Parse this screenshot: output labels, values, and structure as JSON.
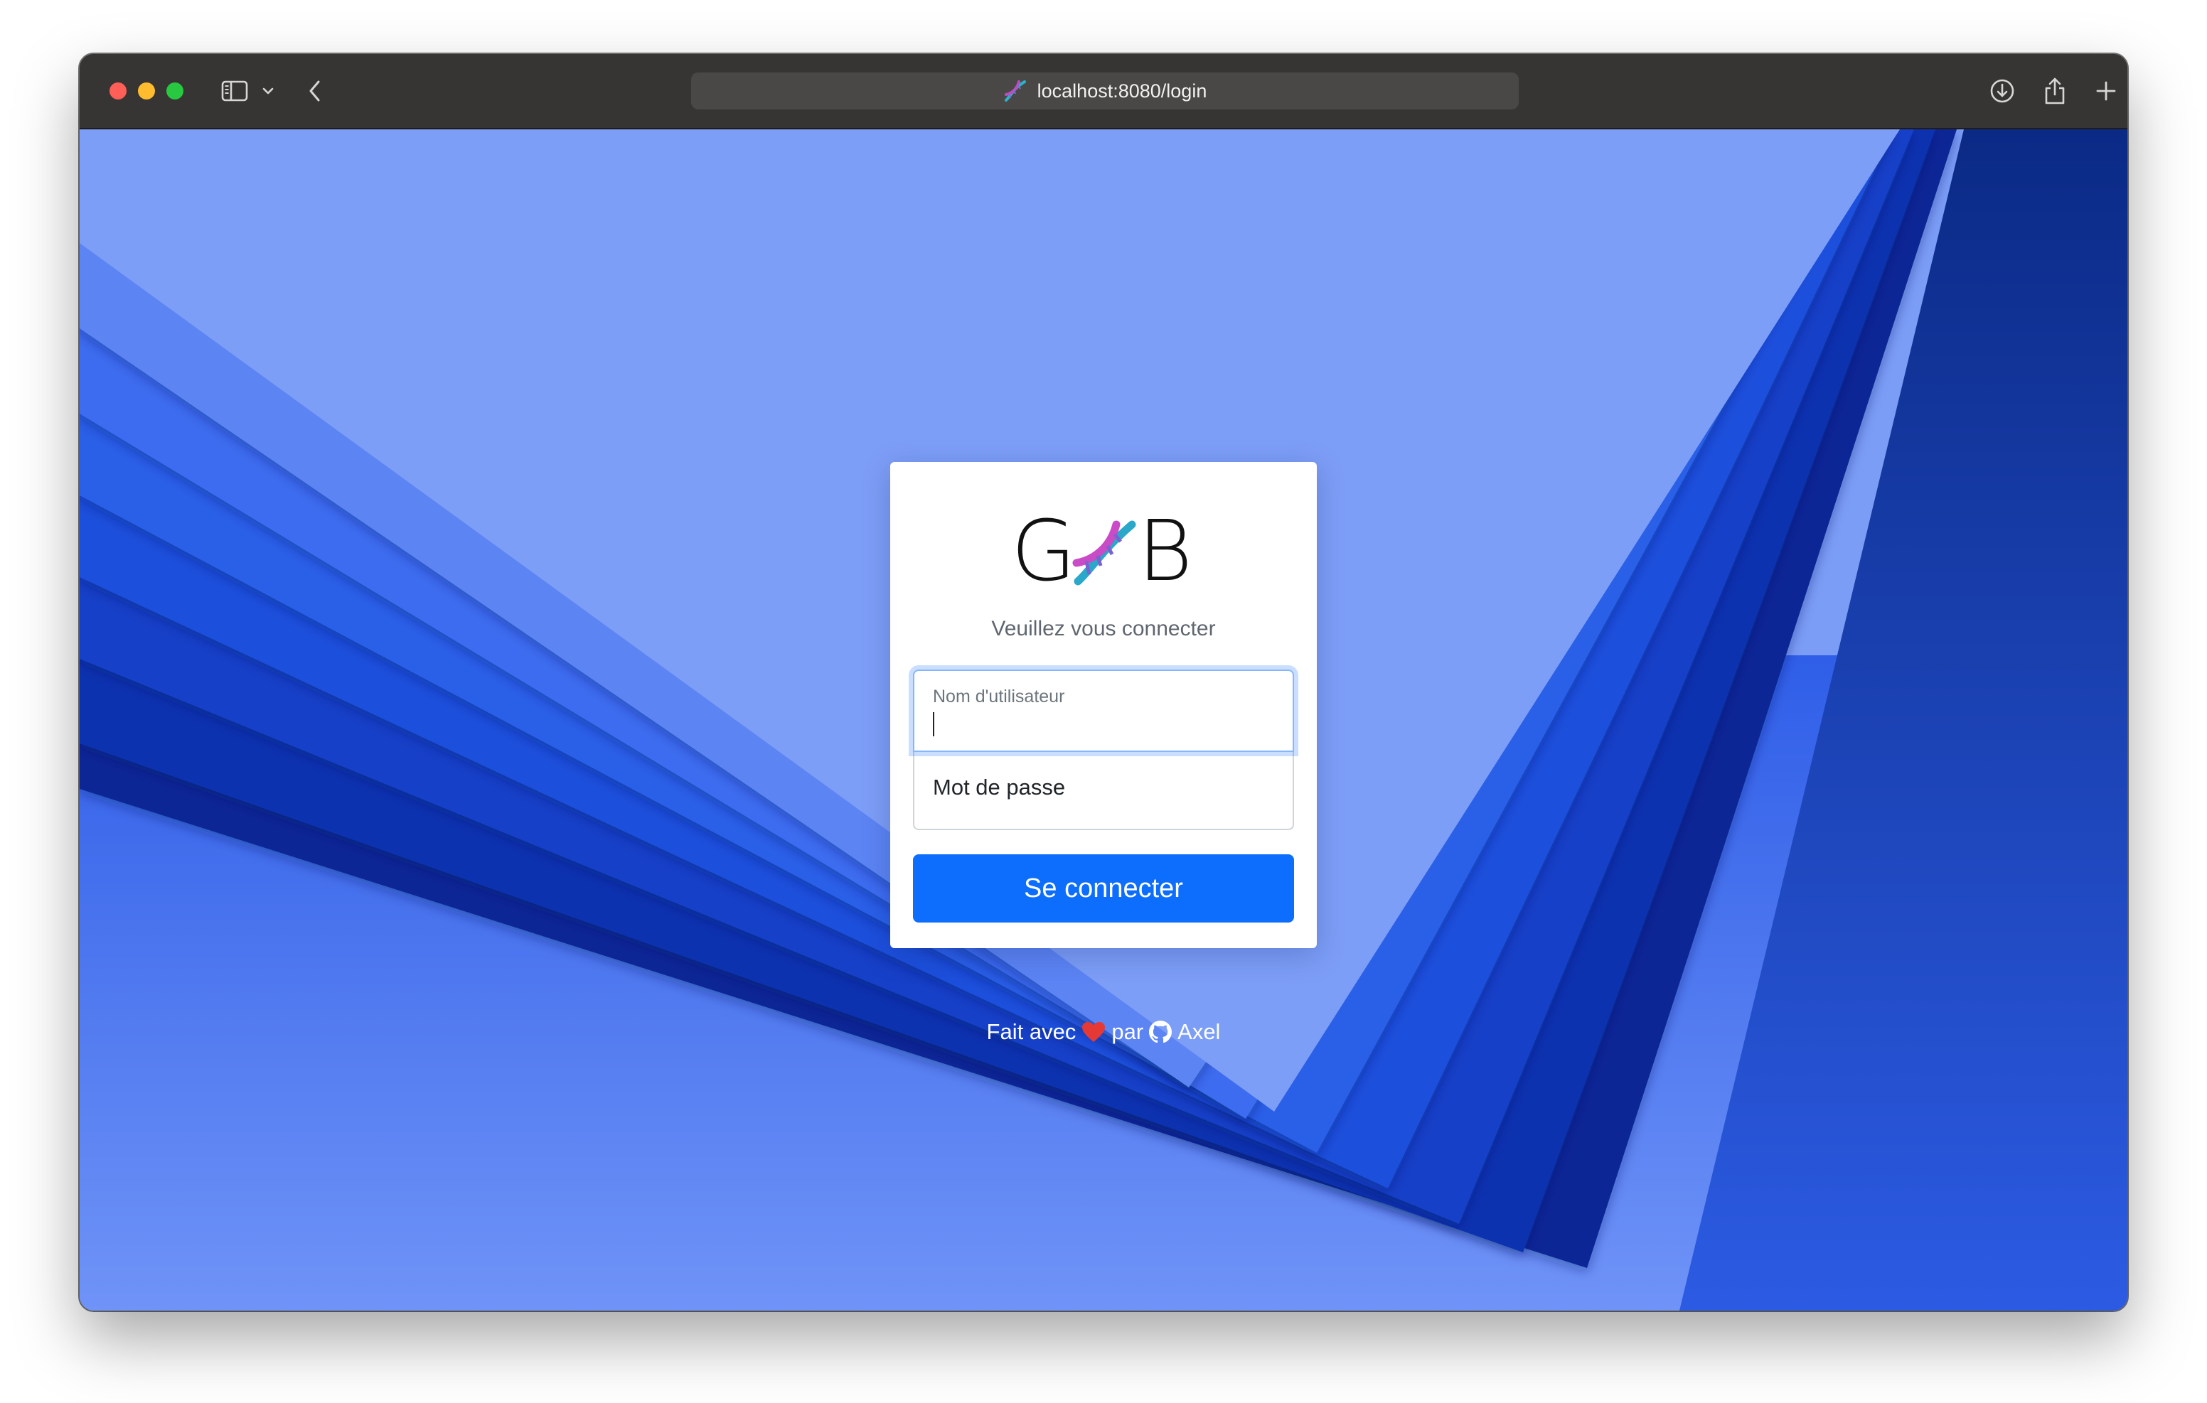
{
  "browser": {
    "url": "localhost:8080/login",
    "buttons": {
      "sidebar": "sidebar-toggle",
      "tab_menu": "chevron-down",
      "back": "chevron-left",
      "downloads": "download",
      "share": "share",
      "new_tab": "plus"
    }
  },
  "login": {
    "logo_left": "G",
    "logo_right": "B",
    "subtitle": "Veuillez vous connecter",
    "username_label": "Nom d'utilisateur",
    "password_placeholder": "Mot de passe",
    "submit_label": "Se connecter"
  },
  "footer": {
    "prefix": "Fait avec",
    "middle": "par",
    "author": "Axel"
  },
  "colors": {
    "primary": "#0d6efd",
    "background_light": "#7a9cf5",
    "background_dark": "#0a2a8f",
    "heart": "#e53935"
  }
}
